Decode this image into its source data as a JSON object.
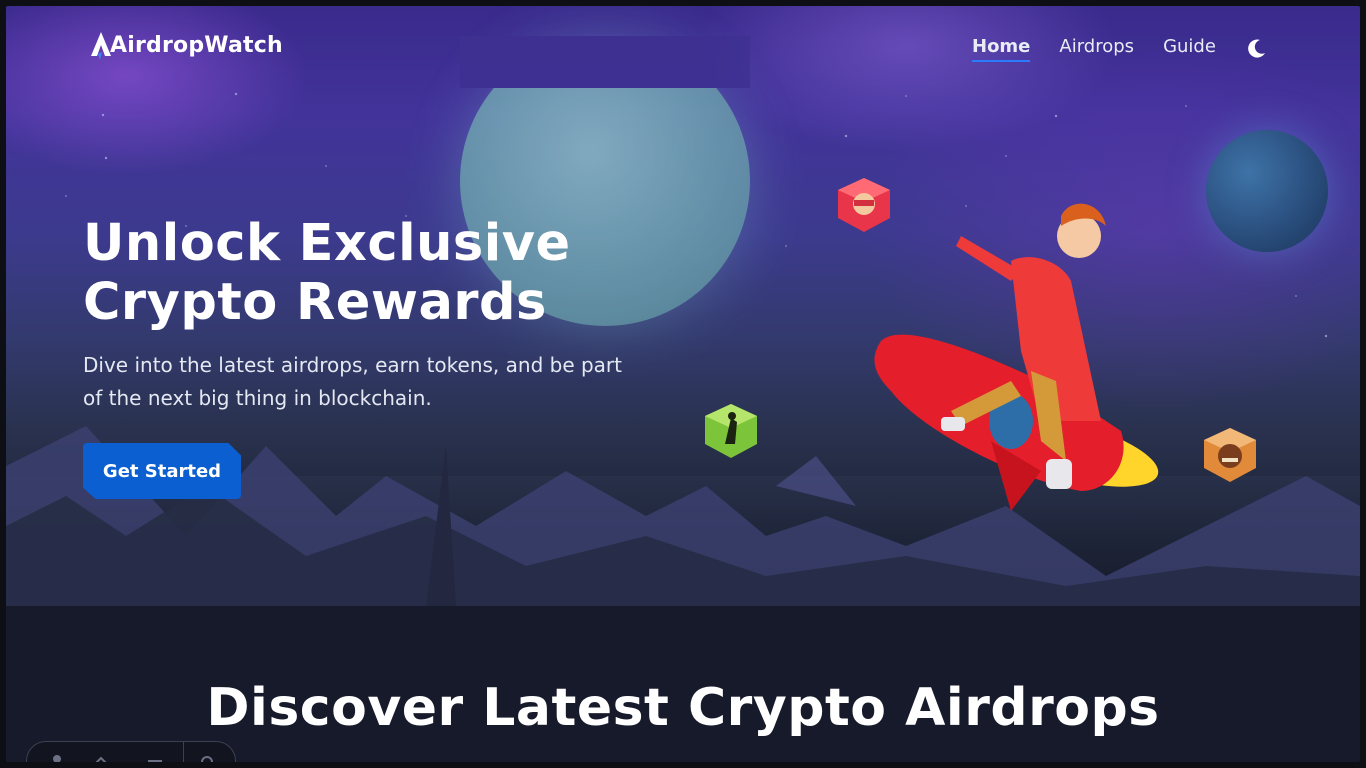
{
  "brand": {
    "name": "AirdropWatch"
  },
  "nav": {
    "links": [
      {
        "label": "Home",
        "active": true
      },
      {
        "label": "Airdrops",
        "active": false
      },
      {
        "label": "Guide",
        "active": false
      }
    ],
    "theme_toggle_icon": "moon-icon"
  },
  "hero": {
    "title_line1": "Unlock Exclusive",
    "title_line2": "Crypto Rewards",
    "subtitle_line1": "Dive into the latest airdrops, earn tokens, and be part",
    "subtitle_line2": "of the next big thing in blockchain.",
    "cta_label": "Get Started"
  },
  "section": {
    "title": "Discover Latest Crypto Airdrops"
  },
  "colors": {
    "accent": "#0c5fd0",
    "nav_underline": "#2b7bff",
    "background": "#161a2a"
  },
  "illustration": {
    "icons": [
      "moon-planet",
      "blue-planet",
      "rocket-rider",
      "red-token-icon",
      "green-token-icon",
      "orange-token-icon"
    ]
  }
}
